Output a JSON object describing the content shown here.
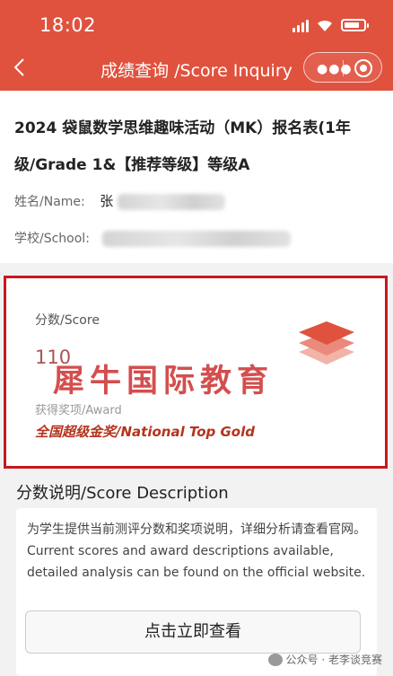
{
  "status_bar": {
    "time": "18:02"
  },
  "nav": {
    "back_icon": "chevron-left-icon",
    "title": "成绩查询 /Score Inquiry",
    "more_icon": "more-dots-icon",
    "close_icon": "record-close-icon"
  },
  "info": {
    "title": "2024 袋鼠数学思维趣味活动（MK）报名表(1年级/Grade 1&【推荐等级】等级A",
    "name_label": "姓名/Name:",
    "name_value": "张",
    "school_label": "学校/School:"
  },
  "score": {
    "label": "分数/Score",
    "value": "110",
    "watermark": "犀牛国际教育",
    "award_label": "获得奖项/Award",
    "award_value": "全国超级金奖/National Top Gold",
    "accent_color": "#c8171d"
  },
  "description": {
    "title": "分数说明/Score Description",
    "text": "为学生提供当前测评分数和奖项说明，详细分析请查看官网。Current scores and award descriptions available, detailed analysis can be found on the official website.",
    "button": "点击立即查看"
  },
  "footer": {
    "text": "公众号 · 老李谈竞赛"
  },
  "colors": {
    "header": "#e0523e",
    "award": "#b5331d"
  }
}
